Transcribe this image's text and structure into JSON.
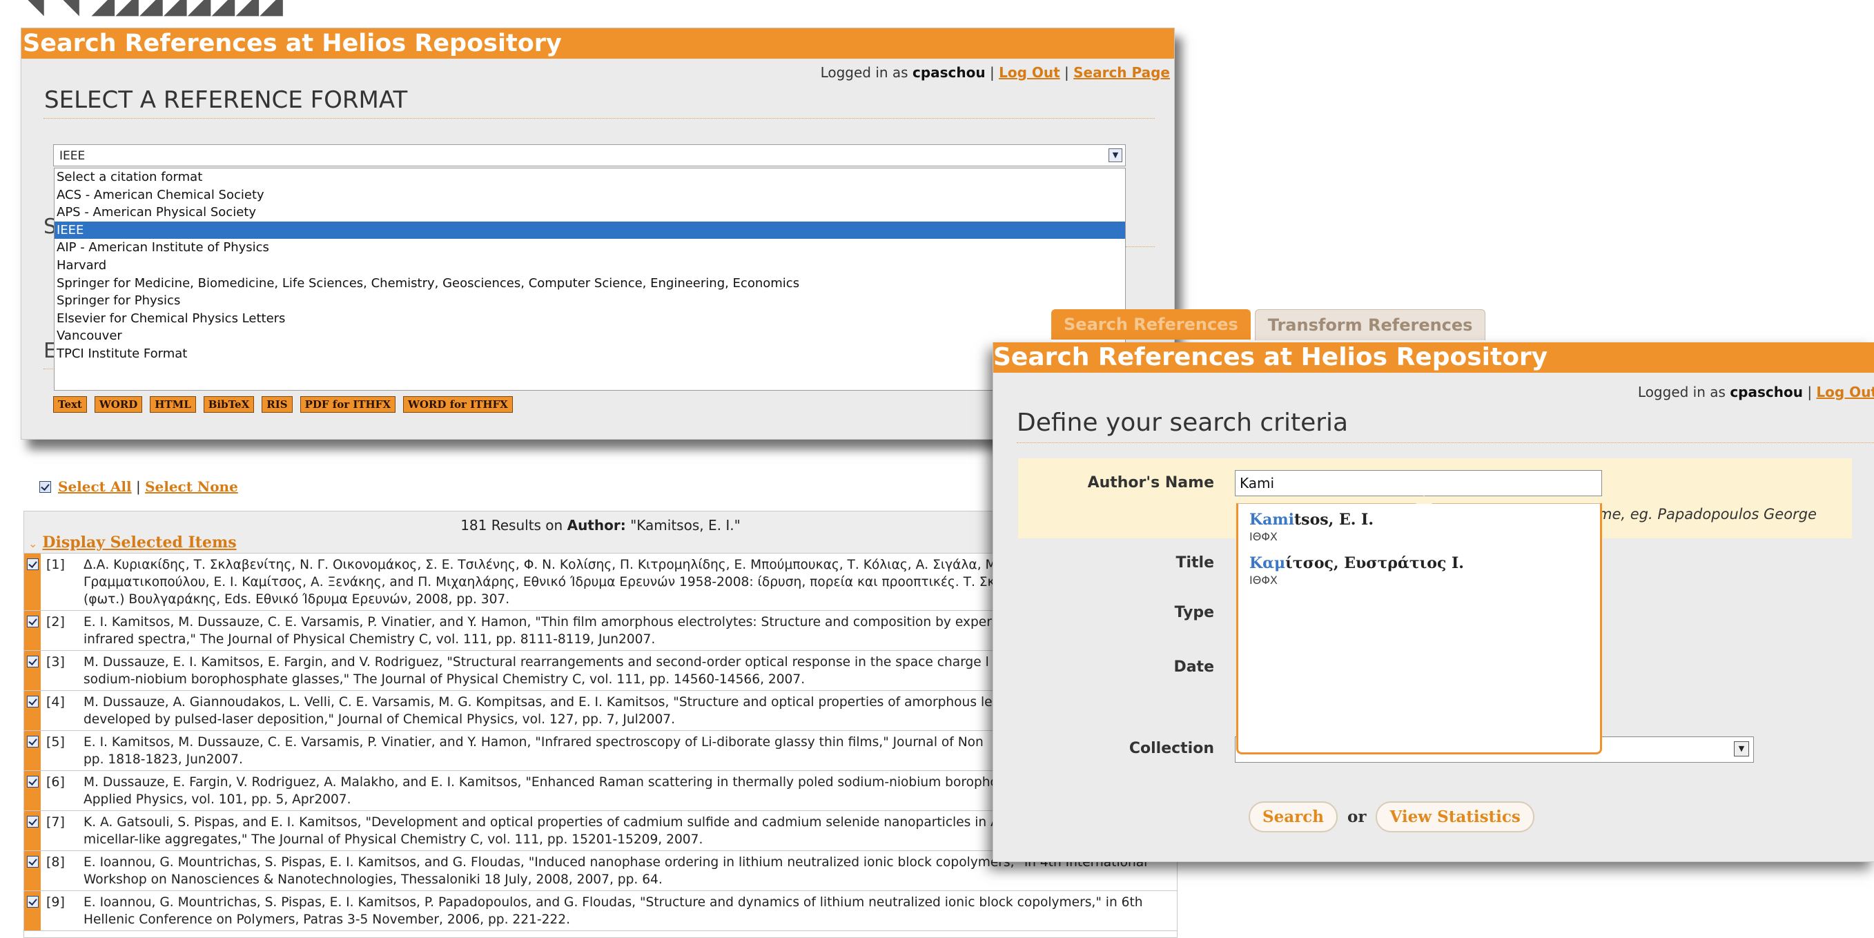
{
  "back_window": {
    "title": "Search References at Helios Repository",
    "logged_in_prefix": "Logged in as",
    "username": "cpaschou",
    "logout_link": "Log Out",
    "search_page_link": "Search Page",
    "heading": "SELECT A REFERENCE FORMAT",
    "format_select": {
      "value": "IEEE",
      "options": [
        "Select a citation format",
        "ACS - American Chemical Society",
        "APS - American Physical Society",
        "IEEE",
        "AIP - American Institute of Physics",
        "Harvard",
        "Springer for Medicine, Biomedicine, Life Sciences, Chemistry, Geosciences, Computer Science, Engineering, Economics",
        "Springer for Physics",
        "Elsevier for Chemical Physics Letters",
        "Vancouver",
        "TPCI Institute Format"
      ],
      "selected_index": 3
    },
    "export_buttons": [
      "Text",
      "WORD",
      "HTML",
      "BibTeX",
      "RIS",
      "PDF for ITHFX",
      "WORD for ITHFX"
    ]
  },
  "results": {
    "select_all": "Select All",
    "separator": "|",
    "select_none": "Select None",
    "count_prefix": "181 Results on",
    "count_field": "Author:",
    "count_query": "\"Kamitsos, E. I.\"",
    "display_selected": "Display Selected Items",
    "items": [
      {
        "num": "[1]",
        "lines": [
          "Δ.Α. Κυριακίδης, Τ. Σκλαβενίτης, Ν. Γ. Οικονομάκος, Σ. Ε. Τσιλένης, Φ. Ν. Κολίσης, Π. Κιτρομηλίδης, Ε. Μπούμπουκας, Τ. Κόλιας, Α. Σιγάλα, Μ. Β",
          "Γραμματικοπούλου, Ε. Ι. Καμίτσος, Α. Ξενάκης, and Π. Μιχαηλάρης, Εθνικό Ίδρυμα Ερευνών 1958-2008: ίδρυση, πορεία και προοπτικές. Τ. Σκλαβ",
          "(φωτ.) Βουλγαράκης, Eds. Εθνικό Ίδρυμα Ερευνών, 2008, pp. 307."
        ]
      },
      {
        "num": "[2]",
        "lines": [
          "E. I. Kamitsos, M. Dussauze, C. E. Varsamis, P. Vinatier, and Y. Hamon, \"Thin film amorphous electrolytes: Structure and composition by exper",
          "infrared spectra,\" The Journal of Physical Chemistry C, vol. 111, pp. 8111-8119, Jun2007."
        ]
      },
      {
        "num": "[3]",
        "lines": [
          "M. Dussauze, E. I. Kamitsos, E. Fargin, and V. Rodriguez, \"Structural rearrangements and second-order optical response in the space charge l",
          "sodium-niobium borophosphate glasses,\" The Journal of Physical Chemistry C, vol. 111, pp. 14560-14566, 2007."
        ]
      },
      {
        "num": "[4]",
        "lines": [
          "M. Dussauze, A. Giannoudakos, L. Velli, C. E. Varsamis, M. G. Kompitsas, and E. I. Kamitsos, \"Structure and optical properties of amorphous le",
          "developed by pulsed-laser deposition,\" Journal of Chemical Physics, vol. 127, pp. 7, Jul2007."
        ]
      },
      {
        "num": "[5]",
        "lines": [
          "E. I. Kamitsos, M. Dussauze, C. E. Varsamis, P. Vinatier, and Y. Hamon, \"Infrared spectroscopy of Li-diborate glassy thin films,\" Journal of Non",
          "pp. 1818-1823, Jun2007."
        ]
      },
      {
        "num": "[6]",
        "lines": [
          "M. Dussauze, E. Fargin, V. Rodriguez, A. Malakho, and E. I. Kamitsos, \"Enhanced Raman scattering in thermally poled sodium-niobium borophc",
          "Applied Physics, vol. 101, pp. 5, Apr2007."
        ]
      },
      {
        "num": "[7]",
        "lines": [
          "K. A. Gatsouli, S. Pispas, and E. I. Kamitsos, \"Development and optical properties of cadmium sulfide and cadmium selenide nanoparticles in A",
          "micellar-like aggregates,\" The Journal of Physical Chemistry C, vol. 111, pp. 15201-15209, 2007."
        ]
      },
      {
        "num": "[8]",
        "lines": [
          "E. Ioannou, G. Mountrichas, S. Pispas, E. I. Kamitsos, and G. Floudas, \"Induced nanophase ordering in lithium neutralized ionic block copolymers,\" in 4th International",
          "Workshop on Nanosciences & Nanotechnologies, Thessaloniki 18 July, 2008, 2007, pp. 64."
        ]
      },
      {
        "num": "[9]",
        "lines": [
          "E. Ioannou, G. Mountrichas, S. Pispas, E. I. Kamitsos, P. Papadopoulos, and G. Floudas, \"Structure and dynamics of lithium neutralized ionic block copolymers,\" in 6th",
          "Hellenic Conference on Polymers, Patras 3-5 November, 2006, pp. 221-222."
        ]
      }
    ]
  },
  "front_window": {
    "tabs": [
      "Search References",
      "Transform References"
    ],
    "title": "Search References at Helios Repository",
    "logged_in_prefix": "Logged in as",
    "username": "cpaschou",
    "logout_link": "Log Out",
    "heading": "Define your search criteria",
    "fields": {
      "author_label": "Author's Name",
      "author_value": "Kami",
      "author_hint": "me, eg. Papadopoulos George",
      "title_label": "Title",
      "type_label": "Type",
      "date_label": "Date",
      "collection_label": "Collection"
    },
    "autocomplete": [
      {
        "match": "Kami",
        "rest": "tsos, E. I.",
        "org": "ΙΘΦΧ"
      },
      {
        "match": "Καμ",
        "rest": "ίτσος, Ευστράτιος Ι.",
        "org": "ΙΘΦΧ"
      }
    ],
    "search_button": "Search",
    "or_text": "or",
    "stats_button": "View Statistics"
  },
  "colors": {
    "accent": "#f0922b",
    "selection": "#2e73c4",
    "link": "#d87b14",
    "highlight": "#3b78c7"
  }
}
